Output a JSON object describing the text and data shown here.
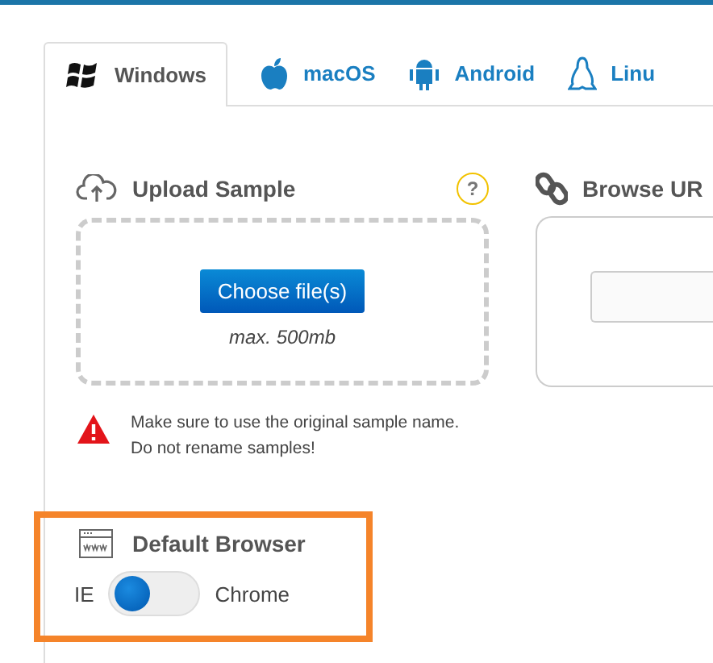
{
  "tabs": [
    {
      "label": "Windows",
      "kind": "windows",
      "selected": true
    },
    {
      "label": "macOS",
      "kind": "apple",
      "selected": false
    },
    {
      "label": "Android",
      "kind": "android",
      "selected": false
    },
    {
      "label": "Linu",
      "kind": "linux",
      "selected": false
    }
  ],
  "upload": {
    "title": "Upload Sample",
    "help": "?",
    "button": "Choose file(s)",
    "limit": "max. 500mb",
    "warning": [
      "Make sure to use the original sample name.",
      "Do not rename samples!"
    ]
  },
  "browse": {
    "title": "Browse UR"
  },
  "default_browser": {
    "title": "Default Browser",
    "left_label": "IE",
    "right_label": "Chrome",
    "on": false
  }
}
